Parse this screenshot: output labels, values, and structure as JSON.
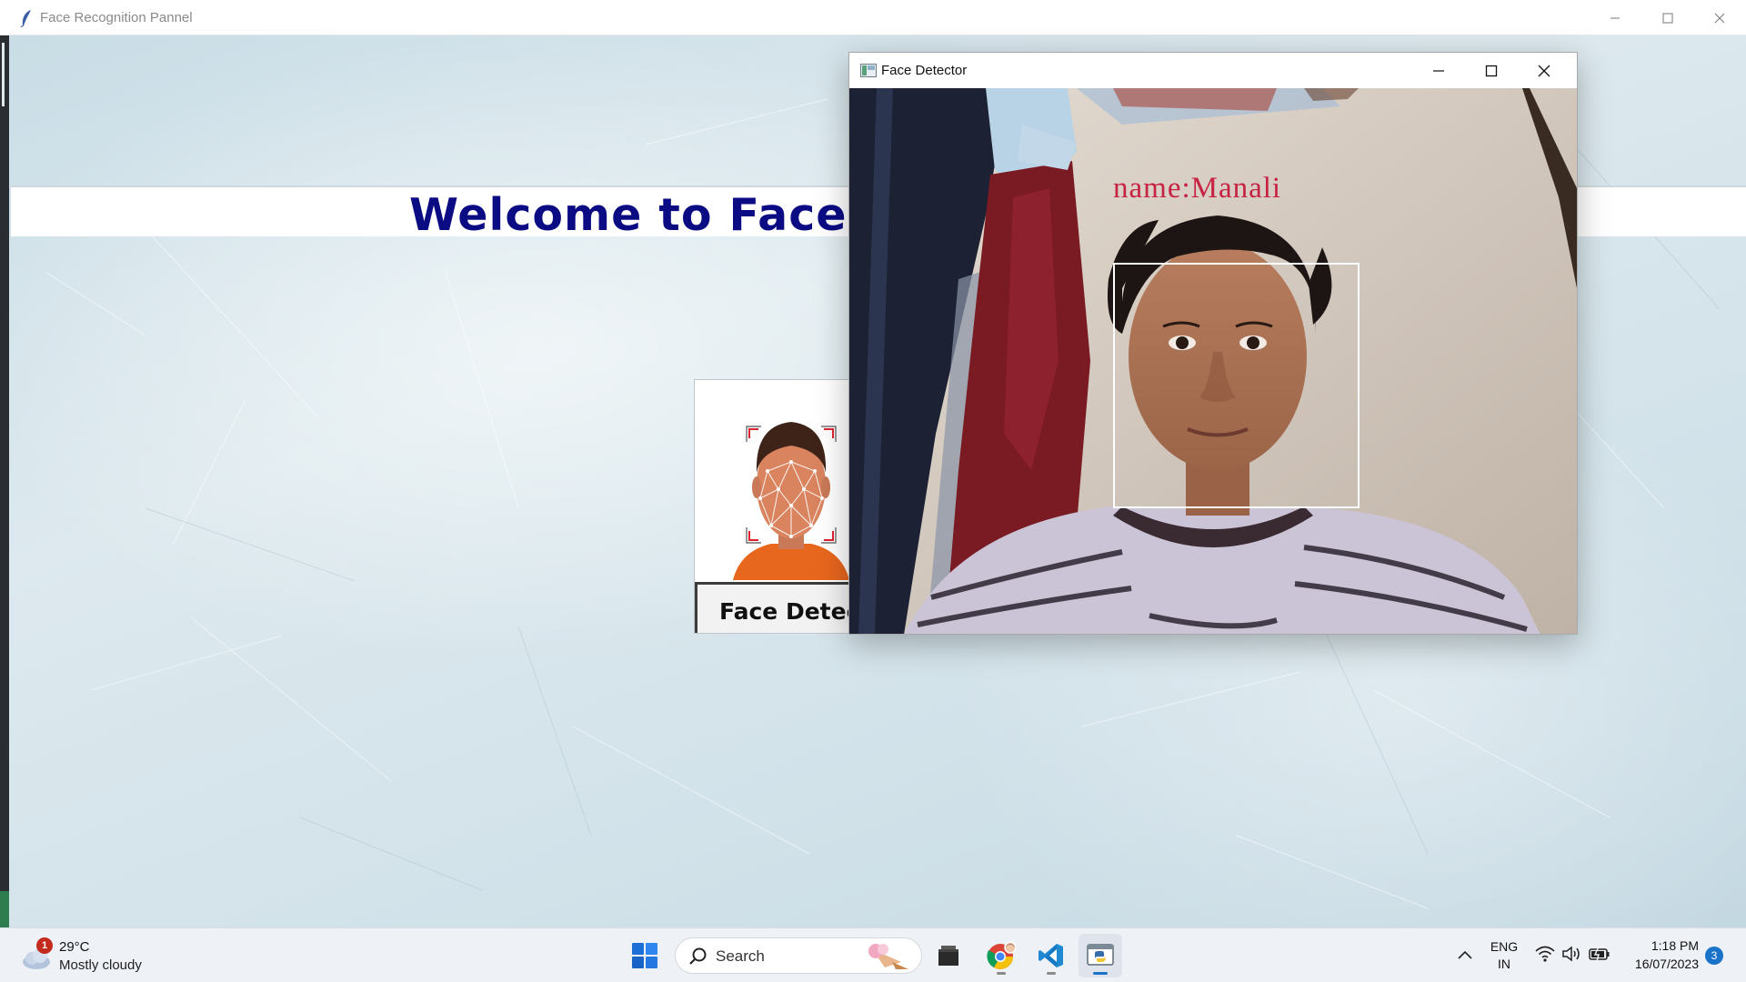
{
  "main_window": {
    "title": "Face Recognition Pannel",
    "welcome_text": "Welcome to Face",
    "face_detector_button_label": "Face Detect",
    "icons": [
      "feather-icon",
      "minimize-icon",
      "maximize-icon",
      "close-icon"
    ]
  },
  "detector_window": {
    "title": "Face Detector",
    "detected_label": "name:Manali",
    "box_color": "#ffffff",
    "label_color": "#c62242"
  },
  "taskbar": {
    "weather": {
      "badge": "1",
      "temperature": "29°C",
      "condition": "Mostly cloudy"
    },
    "search": {
      "label": "Search"
    },
    "pinned_apps": [
      "start-icon",
      "file-explorer-icon",
      "chrome-icon",
      "vscode-icon",
      "python-app-icon"
    ],
    "language": {
      "line1": "ENG",
      "line2": "IN"
    },
    "clock": {
      "time": "1:18 PM",
      "date": "16/07/2023"
    },
    "notification_count": "3"
  },
  "colors": {
    "welcome_text": "#0b0b84",
    "taskbar_bg": "#eef1f6",
    "accent": "#1a73c8"
  }
}
